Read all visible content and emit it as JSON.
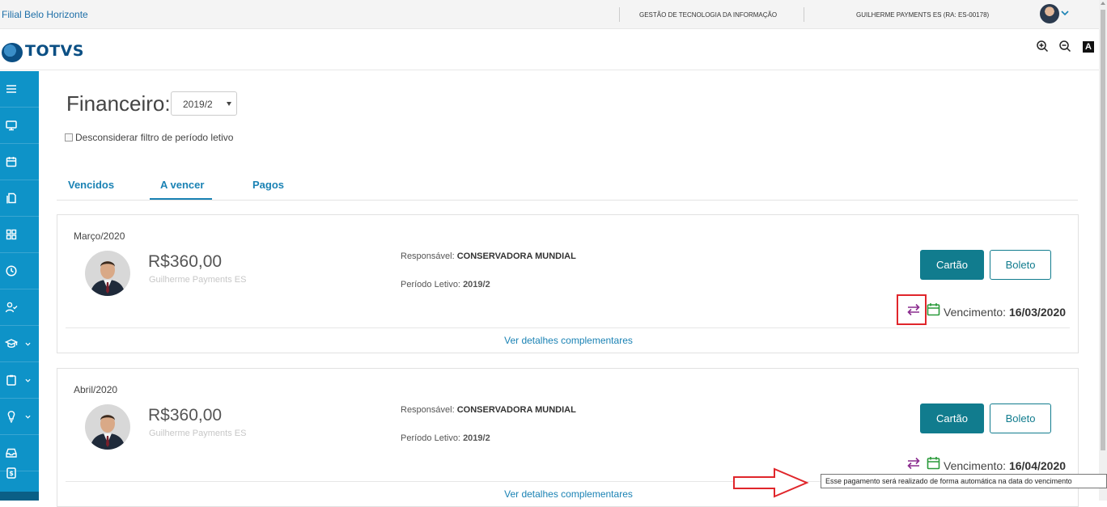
{
  "topbar": {
    "branch": "Filial Belo Horizonte",
    "department": "GESTÃO DE TECNOLOGIA DA INFORMAÇÃO",
    "user": "GUILHERME PAYMENTS ES (RA: ES-00178)"
  },
  "brand": {
    "logo_text": "TOTVS",
    "color": "#0b4f84"
  },
  "accessibility": {
    "contrast_label": "A"
  },
  "sidebar": {
    "color": "#0e93c8",
    "items": [
      {
        "icon": "menu-icon"
      },
      {
        "icon": "monitor-icon"
      },
      {
        "icon": "calendar-icon"
      },
      {
        "icon": "documents-icon"
      },
      {
        "icon": "grid-icon"
      },
      {
        "icon": "clock-icon"
      },
      {
        "icon": "user-check-icon"
      },
      {
        "icon": "graduation-cap-icon",
        "has_caret": true
      },
      {
        "icon": "clipboard-icon",
        "has_caret": true
      },
      {
        "icon": "lightbulb-icon",
        "has_caret": true
      },
      {
        "icon": "inbox-icon"
      },
      {
        "icon": "dollar-document-icon"
      }
    ]
  },
  "page": {
    "title": "Financeiro:",
    "period_selected": "2019/2",
    "ignore_period_filter_label": "Desconsiderar filtro de período letivo"
  },
  "tabs": [
    {
      "label": "Vencidos",
      "active": false
    },
    {
      "label": "A vencer",
      "active": true
    },
    {
      "label": "Pagos",
      "active": false
    }
  ],
  "cards": [
    {
      "month": "Março/2020",
      "amount": "R$360,00",
      "payer": "Guilherme Payments ES",
      "responsible_label": "Responsável:",
      "responsible": "CONSERVADORA MUNDIAL",
      "period_label": "Período Letivo:",
      "period": "2019/2",
      "card_button": "Cartão",
      "slip_button": "Boleto",
      "due_label": "Vencimento:",
      "due_date": "16/03/2020",
      "details_link": "Ver detalhes complementares"
    },
    {
      "month": "Abril/2020",
      "amount": "R$360,00",
      "payer": "Guilherme Payments ES",
      "responsible_label": "Responsável:",
      "responsible": "CONSERVADORA MUNDIAL",
      "period_label": "Período Letivo:",
      "period": "2019/2",
      "card_button": "Cartão",
      "slip_button": "Boleto",
      "due_label": "Vencimento:",
      "due_date": "16/04/2020",
      "details_link": "Ver detalhes complementares"
    }
  ],
  "tooltip": "Esse pagamento será realizado de forma automática na data do vencimento",
  "colors": {
    "primary_button": "#117c8e",
    "link": "#1a82b4",
    "auto_payment_icon": "#8a2b8e",
    "calendar_icon": "#2a9a3a",
    "annotation": "#e0262b"
  }
}
